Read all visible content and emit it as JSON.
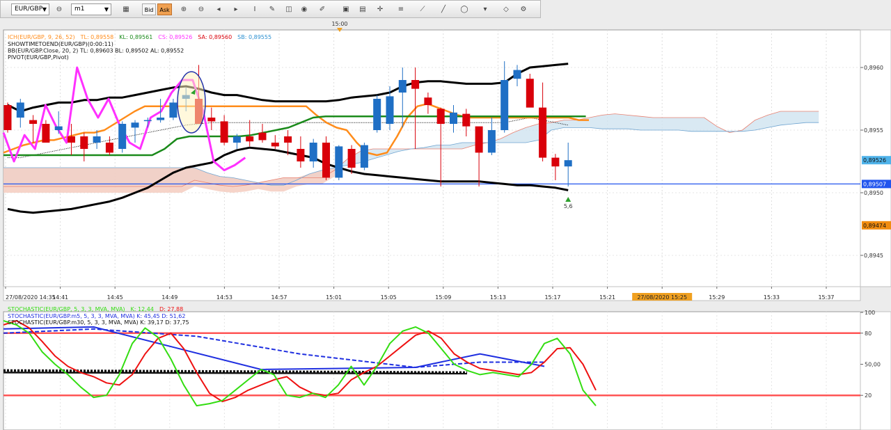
{
  "toolbar": {
    "symbol": "EUR/GBP",
    "timeframe": "m1",
    "bid_label": "Bid",
    "ask_label": "Ask",
    "icons": [
      "chain-icon",
      "chart-type-icon",
      "zoom-in-icon",
      "zoom-out-icon",
      "period-left-icon",
      "period-right-icon",
      "text-tool-icon",
      "paint-icon",
      "globe-icon",
      "pencil-icon",
      "image-icon",
      "layout-icon",
      "crosshair-icon",
      "lines-icon",
      "trendline-icon",
      "line-tool-icon",
      "ellipse-tool-icon",
      "eraser-icon",
      "settings-icon",
      "more-icon"
    ]
  },
  "colors": {
    "candle_up": "#1f6fc5",
    "candle_down": "#d9000a",
    "tenkan": "#ff8c1a",
    "kijun": "#1a8a1a",
    "bands": "#000000",
    "cs": "#ff30ff",
    "cloud_upper": "#e88070",
    "cloud_lower": "#6fa4d0",
    "pivot": "#2255ee",
    "stoch_k": "#33dd11",
    "stoch_d": "#ee1111",
    "stoch_m5": "#1f2fe0",
    "stoch_m30": "#111111",
    "stoch_levels": "#ff5555"
  },
  "chart_data": [
    {
      "type": "candlestick",
      "time_marker": "15:00",
      "legend": [
        {
          "text": "ICH(EUR/GBP, 9, 26, 52)",
          "color": "#ff8c1a"
        },
        {
          "text": "TL: 0,89558",
          "color": "#ff8c1a"
        },
        {
          "text": "KL: 0,89561",
          "color": "#1a8a1a"
        },
        {
          "text": "CS: 0,89526",
          "color": "#ff30ff"
        },
        {
          "text": "SA: 0,89560",
          "color": "#d9000a"
        },
        {
          "text": "SB: 0,89555",
          "color": "#2a8fd0"
        }
      ],
      "legend_lines": [
        "SHOWTIMETOEND(EUR/GBP)(0:00:11)",
        "BB(EUR/GBP.Close, 20, 2)  TL: 0,89603  BL: 0,89502  AL: 0,89552",
        "PIVOT(EUR/GBP,Pivot)"
      ],
      "x_labels": [
        "27/08/2020 14:35",
        "14:41",
        "14:45",
        "14:49",
        "14:53",
        "14:57",
        "15:01",
        "15:05",
        "15:09",
        "15:13",
        "15:17",
        "15:21",
        "27/08/2020 15:25",
        "15:29",
        "15:33",
        "15:37"
      ],
      "highlight_x_label": "27/08/2020 15:25",
      "y_ticks": [
        "0,8960",
        "0,8955",
        "0,8950",
        "0,8945"
      ],
      "y_tick_values": [
        0.896,
        0.8955,
        0.895,
        0.8945
      ],
      "ylim": [
        0.89425,
        0.8963
      ],
      "price_tags": [
        {
          "text": "0,89526",
          "value": 0.89526,
          "bg": "#4fb3ea"
        },
        {
          "text": "0,89507",
          "value": 0.89507,
          "bg": "#2255ee"
        },
        {
          "text": "0,89474",
          "value": 0.89474,
          "bg": "#f08c10"
        }
      ],
      "candles": [
        [
          0.8957,
          0.89572,
          0.89548,
          0.8955
        ],
        [
          0.8956,
          0.89575,
          0.89552,
          0.89572
        ],
        [
          0.89558,
          0.89562,
          0.8954,
          0.89555
        ],
        [
          0.89555,
          0.89558,
          0.89548,
          0.8954
        ],
        [
          0.8955,
          0.89565,
          0.89547,
          0.89553
        ],
        [
          0.89545,
          0.89555,
          0.8953,
          0.8954
        ],
        [
          0.89545,
          0.89548,
          0.89525,
          0.89535
        ],
        [
          0.8954,
          0.8955,
          0.89535,
          0.89545
        ],
        [
          0.8954,
          0.89545,
          0.8953,
          0.89532
        ],
        [
          0.89535,
          0.89557,
          0.89532,
          0.89555
        ],
        [
          0.89552,
          0.89558,
          0.8954,
          0.89556
        ],
        [
          0.89558,
          0.8956,
          0.89552,
          0.89558
        ],
        [
          0.89558,
          0.89575,
          0.89556,
          0.8956
        ],
        [
          0.8956,
          0.89575,
          0.89558,
          0.89572
        ],
        [
          0.89575,
          0.89584,
          0.89565,
          0.89578
        ],
        [
          0.89575,
          0.89602,
          0.89565,
          0.89555
        ],
        [
          0.8956,
          0.89568,
          0.8955,
          0.89557
        ],
        [
          0.89557,
          0.89562,
          0.89538,
          0.8954
        ],
        [
          0.8954,
          0.89547,
          0.89535,
          0.89545
        ],
        [
          0.89545,
          0.89558,
          0.89537,
          0.89541
        ],
        [
          0.89548,
          0.89555,
          0.8954,
          0.89542
        ],
        [
          0.8954,
          0.89546,
          0.89535,
          0.89537
        ],
        [
          0.89545,
          0.8955,
          0.8953,
          0.8954
        ],
        [
          0.89535,
          0.89545,
          0.8952,
          0.89525
        ],
        [
          0.89525,
          0.89543,
          0.8952,
          0.8954
        ],
        [
          0.8954,
          0.89545,
          0.8951,
          0.89512
        ],
        [
          0.89512,
          0.89538,
          0.8951,
          0.89537
        ],
        [
          0.89535,
          0.89538,
          0.89515,
          0.8952
        ],
        [
          0.8952,
          0.8954,
          0.89518,
          0.89538
        ],
        [
          0.8955,
          0.89578,
          0.89548,
          0.89575
        ],
        [
          0.89555,
          0.89585,
          0.8955,
          0.89577
        ],
        [
          0.8958,
          0.896,
          0.89552,
          0.8959
        ],
        [
          0.8959,
          0.896,
          0.89535,
          0.89583
        ],
        [
          0.89576,
          0.8958,
          0.89563,
          0.8957
        ],
        [
          0.89567,
          0.89568,
          0.89505,
          0.89555
        ],
        [
          0.89555,
          0.8957,
          0.89548,
          0.89564
        ],
        [
          0.89563,
          0.89567,
          0.89545,
          0.89553
        ],
        [
          0.89553,
          0.89552,
          0.89505,
          0.89532
        ],
        [
          0.89532,
          0.8956,
          0.8953,
          0.8955
        ],
        [
          0.8955,
          0.89605,
          0.89548,
          0.8959
        ],
        [
          0.89591,
          0.89602,
          0.89585,
          0.89598
        ],
        [
          0.89591,
          0.89595,
          0.8958,
          0.89568
        ],
        [
          0.89568,
          0.89588,
          0.89525,
          0.89528
        ],
        [
          0.89528,
          0.89531,
          0.8951,
          0.89521
        ],
        [
          0.89521,
          0.8954,
          0.89505,
          0.89526
        ]
      ],
      "tenkan": [
        0.89532,
        0.89535,
        0.89538,
        0.8954,
        0.89542,
        0.89542,
        0.89544,
        0.89546,
        0.89548,
        0.89548,
        0.8955,
        0.89555,
        0.8956,
        0.89565,
        0.89569,
        0.89569,
        0.89569,
        0.89569,
        0.89569,
        0.89569,
        0.89569,
        0.89569,
        0.89569,
        0.89569,
        0.89569,
        0.89569,
        0.89569,
        0.89569,
        0.89569,
        0.89569,
        0.89569,
        0.89562,
        0.89556,
        0.89552,
        0.8955,
        0.8954,
        0.89532,
        0.8953,
        0.89532,
        0.89545,
        0.8956,
        0.89569,
        0.89571,
        0.89568,
        0.89565,
        0.89562,
        0.8956,
        0.8956,
        0.8956,
        0.8956,
        0.8956,
        0.8956,
        0.8956,
        0.8956,
        0.8956,
        0.8956,
        0.8956,
        0.89558,
        0.89558
      ],
      "kijun": [
        0.8953,
        0.8953,
        0.8953,
        0.8953,
        0.8953,
        0.8953,
        0.8953,
        0.8953,
        0.8953,
        0.8953,
        0.8953,
        0.8953,
        0.8953,
        0.89535,
        0.89543,
        0.89545,
        0.89545,
        0.89545,
        0.89545,
        0.89545,
        0.89546,
        0.89548,
        0.8955,
        0.89552,
        0.89556,
        0.8956,
        0.89561,
        0.89561,
        0.89561,
        0.89561,
        0.89561,
        0.89561,
        0.89561,
        0.89561,
        0.89561,
        0.89561,
        0.89561,
        0.89561,
        0.89561,
        0.89561,
        0.89561,
        0.89561,
        0.89561,
        0.89561,
        0.89561,
        0.89561,
        0.89561,
        0.89561
      ],
      "chikou": [
        0.89548,
        0.89525,
        0.89546,
        0.89535,
        0.8957,
        0.89553,
        0.8954,
        0.896,
        0.89575,
        0.8956,
        0.89575,
        0.89555,
        0.8954,
        0.89535,
        0.8956,
        0.89565,
        0.8958,
        0.8959,
        0.8959,
        0.89565,
        0.89525,
        0.89518,
        0.89522,
        0.89528
      ],
      "bb_upper": [
        0.8957,
        0.89565,
        0.89568,
        0.8957,
        0.89572,
        0.89572,
        0.89574,
        0.89574,
        0.89576,
        0.89576,
        0.89578,
        0.8958,
        0.89582,
        0.89584,
        0.89585,
        0.89583,
        0.8958,
        0.89578,
        0.89578,
        0.89576,
        0.89574,
        0.89573,
        0.89573,
        0.89573,
        0.89573,
        0.89573,
        0.89574,
        0.89576,
        0.89577,
        0.89578,
        0.8958,
        0.89585,
        0.89588,
        0.89589,
        0.89589,
        0.89588,
        0.89587,
        0.89587,
        0.89587,
        0.89588,
        0.89595,
        0.896,
        0.89601,
        0.89602,
        0.89603
      ],
      "bb_mid": [
        0.89528,
        0.89528,
        0.8953,
        0.89532,
        0.89534,
        0.89536,
        0.89538,
        0.8954,
        0.89542,
        0.89544,
        0.89546,
        0.89548,
        0.8955,
        0.89552,
        0.89554,
        0.89555,
        0.89556,
        0.89556,
        0.89556,
        0.89556,
        0.89556,
        0.89556,
        0.89556,
        0.89556,
        0.89556,
        0.89556,
        0.89556,
        0.89556,
        0.89556,
        0.89556,
        0.89556,
        0.89556,
        0.89556,
        0.89556,
        0.89556,
        0.89556,
        0.89556,
        0.89556,
        0.89556,
        0.89556,
        0.89558,
        0.8956,
        0.89558,
        0.89556,
        0.89554
      ],
      "bb_lower": [
        0.89487,
        0.89485,
        0.89484,
        0.89485,
        0.89486,
        0.89487,
        0.89489,
        0.89491,
        0.89493,
        0.89496,
        0.895,
        0.89504,
        0.8951,
        0.89516,
        0.8952,
        0.89522,
        0.89524,
        0.8953,
        0.89534,
        0.89536,
        0.89535,
        0.89534,
        0.89532,
        0.8953,
        0.89528,
        0.89523,
        0.8952,
        0.89517,
        0.89515,
        0.89514,
        0.89513,
        0.89512,
        0.89511,
        0.8951,
        0.89509,
        0.89509,
        0.89509,
        0.89509,
        0.89508,
        0.89507,
        0.89506,
        0.89506,
        0.89505,
        0.89504,
        0.89502
      ],
      "senkou_a": [
        0.89505,
        0.89505,
        0.89505,
        0.89505,
        0.89505,
        0.89505,
        0.89505,
        0.89505,
        0.89505,
        0.89505,
        0.89505,
        0.89505,
        0.89505,
        0.89505,
        0.89505,
        0.8951,
        0.89508,
        0.89506,
        0.89505,
        0.89506,
        0.89508,
        0.8951,
        0.89512,
        0.89512,
        0.89512,
        0.89512,
        0.89518,
        0.89527,
        0.89533,
        0.89535,
        0.89535,
        0.89535,
        0.89535,
        0.89535,
        0.89535,
        0.89535,
        0.89535,
        0.89538,
        0.8954,
        0.89543,
        0.89548,
        0.89552,
        0.89555,
        0.89556,
        0.89558,
        0.89558,
        0.8956,
        0.89562,
        0.89563,
        0.89562,
        0.89561,
        0.8956,
        0.8956,
        0.8956,
        0.8956,
        0.8956,
        0.89553,
        0.89548,
        0.8955,
        0.89558,
        0.89562,
        0.89565,
        0.89565,
        0.89565,
        0.89565
      ],
      "senkou_b": [
        0.8952,
        0.8952,
        0.8952,
        0.8952,
        0.8952,
        0.8952,
        0.8952,
        0.8952,
        0.8952,
        0.8952,
        0.8952,
        0.8952,
        0.8952,
        0.8952,
        0.8952,
        0.8952,
        0.89516,
        0.89513,
        0.89512,
        0.8951,
        0.89508,
        0.89506,
        0.89506,
        0.8951,
        0.89515,
        0.89518,
        0.8952,
        0.89522,
        0.89524,
        0.89527,
        0.8953,
        0.89533,
        0.89535,
        0.89536,
        0.89538,
        0.89538,
        0.8954,
        0.8954,
        0.8954,
        0.8954,
        0.8954,
        0.8954,
        0.89542,
        0.8955,
        0.89552,
        0.89552,
        0.89552,
        0.89551,
        0.89551,
        0.89551,
        0.8955,
        0.8955,
        0.8955,
        0.8955,
        0.89549,
        0.89549,
        0.89549,
        0.89549,
        0.89549,
        0.8955,
        0.89552,
        0.89554,
        0.89555,
        0.89556,
        0.89556
      ],
      "pivot": 0.89507,
      "annotation": {
        "text": "5,6",
        "bar": 44
      }
    },
    {
      "type": "line",
      "legend": [
        {
          "text": "STOCHASTIC(EUR/GBP, 5, 3, 3, MVA, MVA)",
          "color": "#33dd11"
        },
        {
          "text": "K: 12,44",
          "color": "#33dd11"
        },
        {
          "text": "D: 27,88",
          "color": "#ee1111"
        }
      ],
      "legend_lines": [
        "STOCHASTIC(EUR/GBP.m5, 5, 3, 3, MVA, MVA)   K: 45,45   D: 51,62",
        "STOCHASTIC(EUR/GBP.m30, 5, 3, 3, MVA, MVA)   K: 39,17   D: 37,75"
      ],
      "y_ticks": [
        "100",
        "80",
        "50,00",
        "20"
      ],
      "y_tick_values": [
        100,
        80,
        50,
        20
      ],
      "ylim": [
        0,
        100
      ],
      "levels": [
        80,
        20
      ],
      "k": [
        92,
        88,
        80,
        62,
        50,
        40,
        28,
        18,
        20,
        40,
        70,
        85,
        76,
        55,
        30,
        10,
        12,
        15,
        25,
        35,
        45,
        40,
        20,
        18,
        22,
        18,
        30,
        48,
        30,
        48,
        70,
        82,
        86,
        80,
        65,
        50,
        44,
        40,
        42,
        40,
        38,
        50,
        70,
        75,
        60,
        25,
        10
      ],
      "d": [
        88,
        92,
        85,
        72,
        58,
        48,
        42,
        38,
        32,
        30,
        40,
        60,
        75,
        80,
        65,
        42,
        22,
        14,
        18,
        25,
        30,
        35,
        38,
        28,
        22,
        20,
        22,
        35,
        42,
        48,
        58,
        68,
        78,
        82,
        75,
        60,
        52,
        46,
        44,
        42,
        40,
        42,
        52,
        65,
        66,
        50,
        25
      ],
      "m5_k": [
        {
          "x": 0,
          "v": 84
        },
        {
          "x": 7,
          "v": 86
        },
        {
          "x": 20,
          "v": 45
        },
        {
          "x": 32,
          "v": 47
        },
        {
          "x": 37,
          "v": 60
        },
        {
          "x": 42,
          "v": 48
        }
      ],
      "m5_d": [
        {
          "x": 0,
          "v": 80
        },
        {
          "x": 7,
          "v": 84
        },
        {
          "x": 15,
          "v": 77
        },
        {
          "x": 23,
          "v": 60
        },
        {
          "x": 32,
          "v": 47
        },
        {
          "x": 37,
          "v": 52
        },
        {
          "x": 42,
          "v": 52
        }
      ],
      "m30_k": [
        {
          "x": 0,
          "v": 42
        },
        {
          "x": 36,
          "v": 41
        }
      ],
      "m30_d": [
        {
          "x": 0,
          "v": 44
        },
        {
          "x": 36,
          "v": 42
        }
      ]
    }
  ]
}
